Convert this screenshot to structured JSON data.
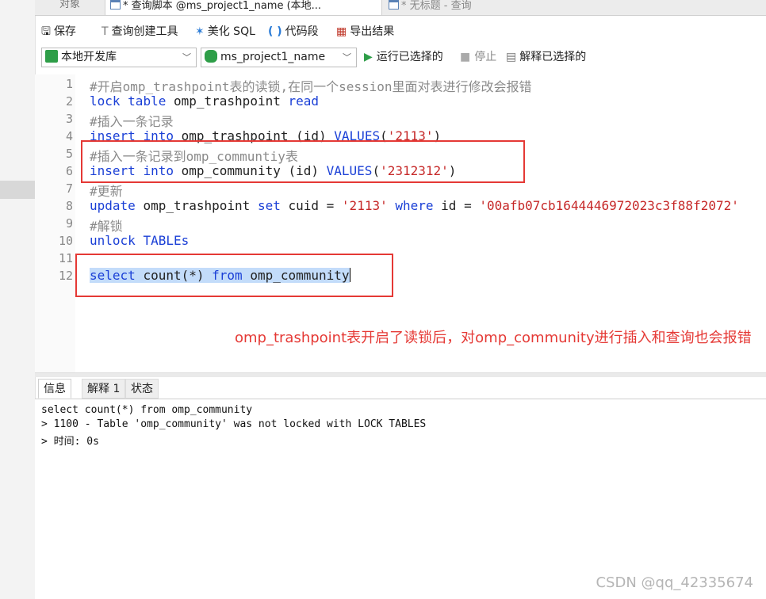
{
  "tabs": {
    "objects": "对象",
    "query": "* 查询脚本 @ms_project1_name (本地...",
    "untitled": "* 无标题 - 查询"
  },
  "toolbar": {
    "save": "保存",
    "query_builder": "查询创建工具",
    "beautify": "美化 SQL",
    "snippet": "代码段",
    "export": "导出结果"
  },
  "connection": {
    "value": "本地开发库"
  },
  "database": {
    "value": "ms_project1_name"
  },
  "run": {
    "run_selected": "运行已选择的",
    "stop": "停止",
    "explain_selected": "解释已选择的"
  },
  "editor": {
    "line_numbers": [
      "1",
      "2",
      "3",
      "4",
      "5",
      "6",
      "7",
      "8",
      "9",
      "10",
      "11",
      "12"
    ],
    "l1": "#开启omp_trashpoint表的读锁,在同一个session里面对表进行修改会报错",
    "l2": {
      "kw1": "lock",
      "kw2": "table",
      "id": "omp_trashpoint",
      "kw3": "read"
    },
    "l3": "#插入一条记录",
    "l4": {
      "kw1": "insert",
      "kw2": "into",
      "id": "omp_trashpoint (id)",
      "kw3": "VALUES",
      "str": "'2113'"
    },
    "l5": "#插入一条记录到omp_communtiy表",
    "l6": {
      "kw1": "insert",
      "kw2": "into",
      "id": "omp_community (id)",
      "kw3": "VALUES",
      "str": "'2312312'"
    },
    "l7": "#更新",
    "l8": {
      "kw1": "update",
      "id1": "omp_trashpoint",
      "kw2": "set",
      "id2": "cuid =",
      "str1": "'2113'",
      "kw3": "where",
      "id3": "id =",
      "str2": "'00afb07cb1644446972023c3f88f2072'"
    },
    "l9": "#解锁",
    "l10": {
      "kw1": "unlock",
      "kw2": "TABLEs"
    },
    "l12": {
      "kw1": "select",
      "id1": "count(*)",
      "kw2": "from",
      "id2": "omp_community"
    }
  },
  "annotation": "omp_trashpoint表开启了读锁后，对omp_community进行插入和查询也会报错",
  "result_tabs": {
    "info": "信息",
    "explain": "解释 1",
    "status": "状态"
  },
  "result": {
    "line1": "select count(*) from omp_community",
    "line2": "> 1100 - Table 'omp_community' was not locked with LOCK TABLES",
    "line3": "> 时间: 0s"
  },
  "watermark": "CSDN @qq_42335674",
  "colors": {
    "keyword": "#1a3fd6",
    "string": "#c62828",
    "comment": "#8a8a8a",
    "annotation": "#e53935"
  }
}
